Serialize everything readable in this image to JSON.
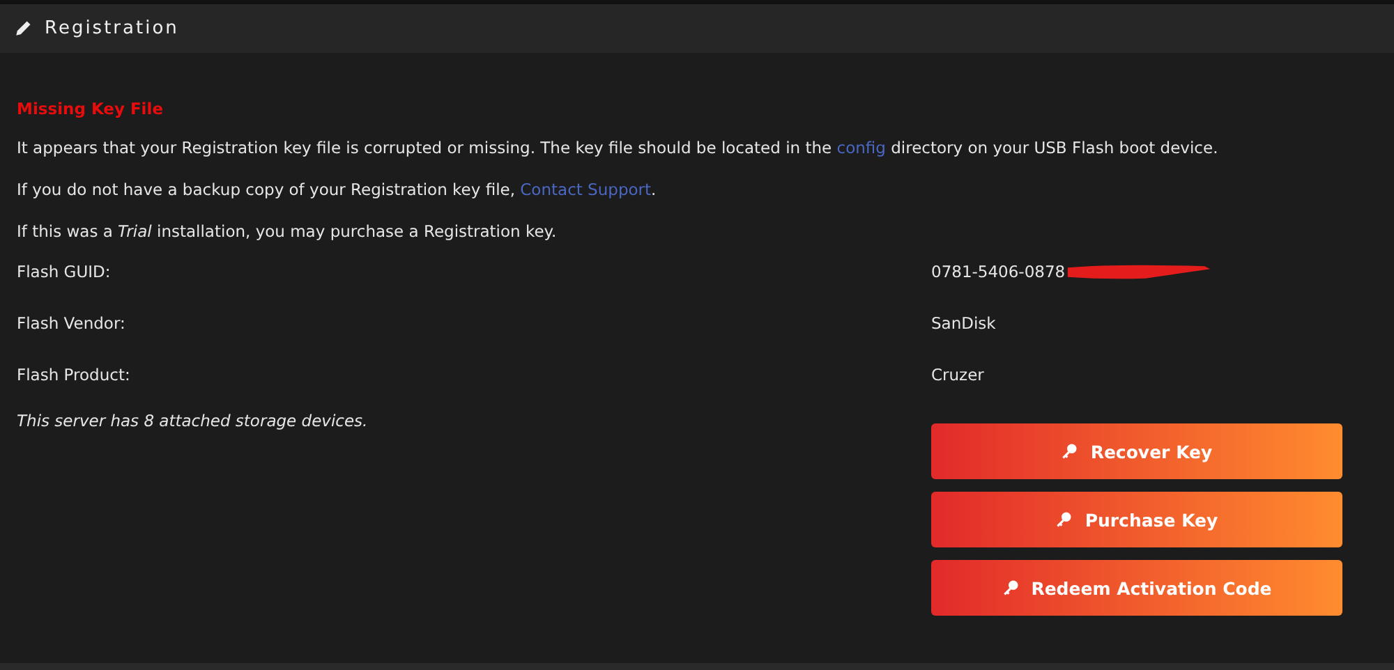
{
  "panel": {
    "title": "Registration"
  },
  "heading": "Missing Key File",
  "paragraphs": [
    [
      {
        "kind": "text",
        "text": "It appears that your Registration key file is corrupted or missing. The key file should be located in the "
      },
      {
        "kind": "link",
        "text": "config"
      },
      {
        "kind": "text",
        "text": " directory on your USB Flash boot device."
      }
    ],
    [
      {
        "kind": "text",
        "text": "If you do not have a backup copy of your Registration key file, "
      },
      {
        "kind": "link",
        "text": "Contact Support"
      },
      {
        "kind": "text",
        "text": "."
      }
    ],
    [
      {
        "kind": "text",
        "text": "If this was a *Trial* installation, you may purchase a Registration key."
      }
    ]
  ],
  "fields": [
    {
      "label": "Flash GUID:",
      "value": "0781-5406-0878",
      "redacted": true
    },
    {
      "label": "Flash Vendor:",
      "value": "SanDisk",
      "redacted": false
    },
    {
      "label": "Flash Product:",
      "value": "Cruzer",
      "redacted": false
    }
  ],
  "note": "This server has 8 attached storage devices.",
  "buttons": [
    "Recover Key",
    "Purchase Key",
    "Redeem Activation Code"
  ]
}
